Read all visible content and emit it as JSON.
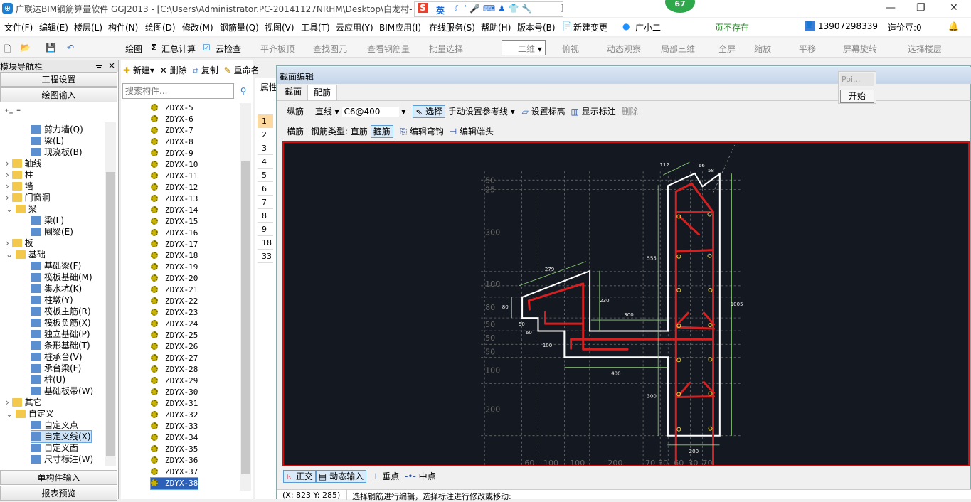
{
  "app": {
    "title": "广联达BIM钢筋算量软件 GGJ2013 - [C:\\Users\\Administrator.PC-20141127NRHM\\Desktop\\白龙村-",
    "title_tail": "]",
    "badge": "67",
    "ime_label": "英"
  },
  "menu": [
    "文件(F)",
    "编辑(E)",
    "楼层(L)",
    "构件(N)",
    "绘图(D)",
    "修改(M)",
    "钢筋量(Q)",
    "视图(V)",
    "工具(T)",
    "云应用(Y)",
    "BIM应用(I)",
    "在线服务(S)",
    "帮助(H)",
    "版本号(B)",
    "新建变更",
    "广小二"
  ],
  "menu_status": "页不存在",
  "account": {
    "phone": "13907298339",
    "beans": "造价豆:0"
  },
  "toolbar": {
    "draw": "绘图",
    "sum": "汇总计算",
    "cloud_check": "云检查",
    "align_top": "平齐板顶",
    "find": "查找图元",
    "view_rebar": "查看钢筋量",
    "batch": "批量选择",
    "view_mode": "二维",
    "top_view": "俯视",
    "dynamic": "动态观察",
    "local3d": "局部三维",
    "fullscreen": "全屏",
    "zoom": "缩放",
    "pan": "平移",
    "rotate": "屏幕旋转",
    "floor": "选择楼层"
  },
  "nav": {
    "title": "模块导航栏",
    "project_settings": "工程设置",
    "draw_input": "绘图输入",
    "single_input": "单构件输入",
    "report": "报表预览",
    "tree": [
      {
        "label": "剪力墙(Q)",
        "level": 2
      },
      {
        "label": "梁(L)",
        "level": 2
      },
      {
        "label": "现浇板(B)",
        "level": 2
      },
      {
        "label": "轴线",
        "level": 1
      },
      {
        "label": "柱",
        "level": 1
      },
      {
        "label": "墙",
        "level": 1
      },
      {
        "label": "门窗洞",
        "level": 1
      },
      {
        "label": "梁",
        "level": 1
      },
      {
        "label": "梁(L)",
        "level": 2
      },
      {
        "label": "圈梁(E)",
        "level": 2
      },
      {
        "label": "板",
        "level": 1
      },
      {
        "label": "基础",
        "level": 1
      },
      {
        "label": "基础梁(F)",
        "level": 2
      },
      {
        "label": "筏板基础(M)",
        "level": 2
      },
      {
        "label": "集水坑(K)",
        "level": 2
      },
      {
        "label": "柱墩(Y)",
        "level": 2
      },
      {
        "label": "筏板主筋(R)",
        "level": 2
      },
      {
        "label": "筏板负筋(X)",
        "level": 2
      },
      {
        "label": "独立基础(P)",
        "level": 2
      },
      {
        "label": "条形基础(T)",
        "level": 2
      },
      {
        "label": "桩承台(V)",
        "level": 2
      },
      {
        "label": "承台梁(F)",
        "level": 2
      },
      {
        "label": "桩(U)",
        "level": 2
      },
      {
        "label": "基础板带(W)",
        "level": 2
      },
      {
        "label": "其它",
        "level": 1
      },
      {
        "label": "自定义",
        "level": 1
      },
      {
        "label": "自定义点",
        "level": 2
      },
      {
        "label": "自定义线(X)",
        "level": 2,
        "selected": true
      },
      {
        "label": "自定义面",
        "level": 2
      },
      {
        "label": "尺寸标注(W)",
        "level": 2
      }
    ]
  },
  "components": {
    "new": "新建",
    "delete": "删除",
    "copy": "复制",
    "rename": "重命名",
    "search_placeholder": "搜索构件...",
    "items": [
      "ZDYX-5",
      "ZDYX-6",
      "ZDYX-7",
      "ZDYX-8",
      "ZDYX-9",
      "ZDYX-10",
      "ZDYX-11",
      "ZDYX-12",
      "ZDYX-13",
      "ZDYX-14",
      "ZDYX-15",
      "ZDYX-16",
      "ZDYX-17",
      "ZDYX-18",
      "ZDYX-19",
      "ZDYX-20",
      "ZDYX-21",
      "ZDYX-22",
      "ZDYX-23",
      "ZDYX-24",
      "ZDYX-25",
      "ZDYX-26",
      "ZDYX-27",
      "ZDYX-28",
      "ZDYX-29",
      "ZDYX-30",
      "ZDYX-31",
      "ZDYX-32",
      "ZDYX-33",
      "ZDYX-34",
      "ZDYX-35",
      "ZDYX-36",
      "ZDYX-37",
      "ZDYX-38"
    ],
    "selected": "ZDYX-38"
  },
  "props": {
    "header": "属性",
    "rows": [
      "1",
      "2",
      "3",
      "4",
      "5",
      "6",
      "7",
      "8",
      "9",
      "18",
      "33"
    ]
  },
  "dialog": {
    "title": "截面编辑",
    "tabs": [
      "截面",
      "配筋"
    ],
    "active_tab": "配筋",
    "row1": {
      "label": "纵筋",
      "line": "直线",
      "spec": "C6@400",
      "select": "选择",
      "manual": "手动设置参考线",
      "set_elev": "设置标高",
      "show_dim": "显示标注",
      "delete": "删除"
    },
    "row2": {
      "label": "横筋",
      "type_label": "钢筋类型:",
      "straight": "直筋",
      "stirrup": "箍筋",
      "edit_hook": "编辑弯钩",
      "edit_end": "编辑端头"
    },
    "bottom": {
      "ortho": "正交",
      "dynamic": "动态输入",
      "perp": "垂点",
      "mid": "中点"
    },
    "coords": "(X: 823 Y: 285)",
    "hint": "选择钢筋进行编辑，选择标注进行修改或移动:"
  },
  "popup": {
    "label": "Poi...",
    "start": "开始"
  },
  "drawing": {
    "left_axis": [
      "50",
      "25",
      "300",
      "100",
      "80",
      "50",
      "50",
      "50",
      "100",
      "200"
    ],
    "bottom_axis": [
      "60",
      "100",
      "100",
      "200",
      "70",
      "30",
      "60",
      "30",
      "70"
    ],
    "dims": [
      "112",
      "66",
      "58",
      "555",
      "1005",
      "279",
      "80",
      "230",
      "300",
      "50",
      "60",
      "100",
      "400",
      "300",
      "200"
    ],
    "colors": {
      "background": "#141820",
      "outline": "#ffffff",
      "rebar": "#d42020",
      "dimension": "#8fd07a",
      "grid": "#777777"
    }
  }
}
